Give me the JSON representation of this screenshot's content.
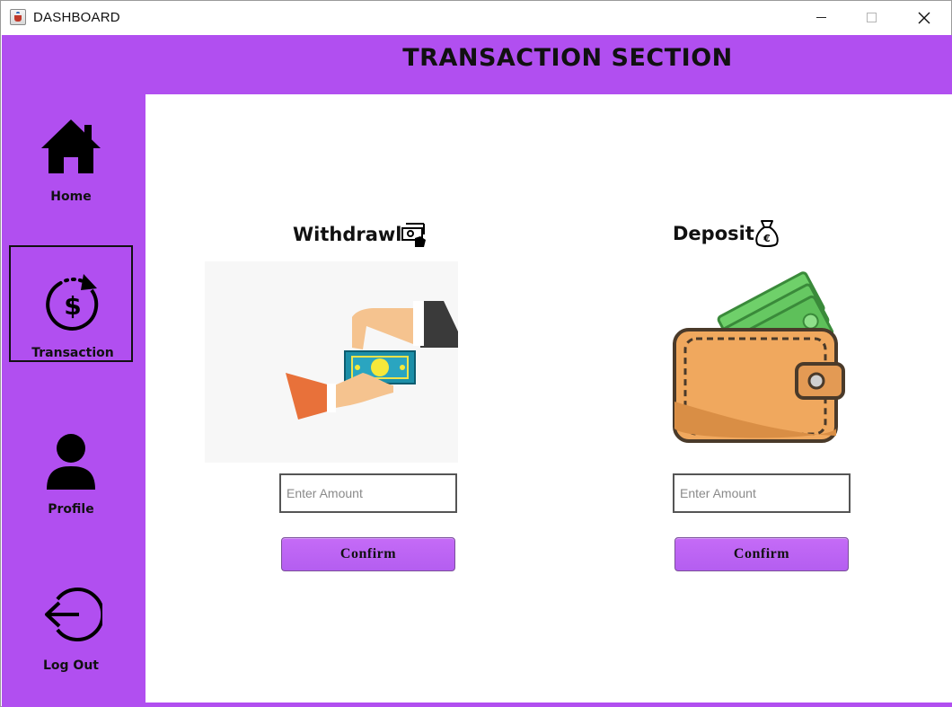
{
  "window": {
    "title": "DASHBOARD"
  },
  "header": {
    "title": "TRANSACTION SECTION"
  },
  "sidebar": {
    "items": [
      {
        "label": "Home",
        "icon": "home-icon",
        "active": false
      },
      {
        "label": "Transaction",
        "icon": "dollar-cycle-icon",
        "active": true
      },
      {
        "label": "Profile",
        "icon": "user-icon",
        "active": false
      },
      {
        "label": "Log Out",
        "icon": "logout-icon",
        "active": false
      }
    ]
  },
  "withdraw": {
    "heading": "Withdrawl",
    "heading_icon": "cash-hand-icon",
    "illustration": "hands-exchanging-money-illustration",
    "amount_placeholder": "Enter Amount",
    "amount_value": "",
    "confirm_label": "Confirm"
  },
  "deposit": {
    "heading": "Deposit",
    "heading_icon": "money-bag-euro-icon",
    "illustration": "wallet-with-cash-illustration",
    "amount_placeholder": "Enter Amount",
    "amount_value": "",
    "confirm_label": "Confirm"
  },
  "colors": {
    "accent": "#b14ff0",
    "button": "#c56bf7",
    "content_bg": "#ffffff",
    "text": "#111111"
  }
}
